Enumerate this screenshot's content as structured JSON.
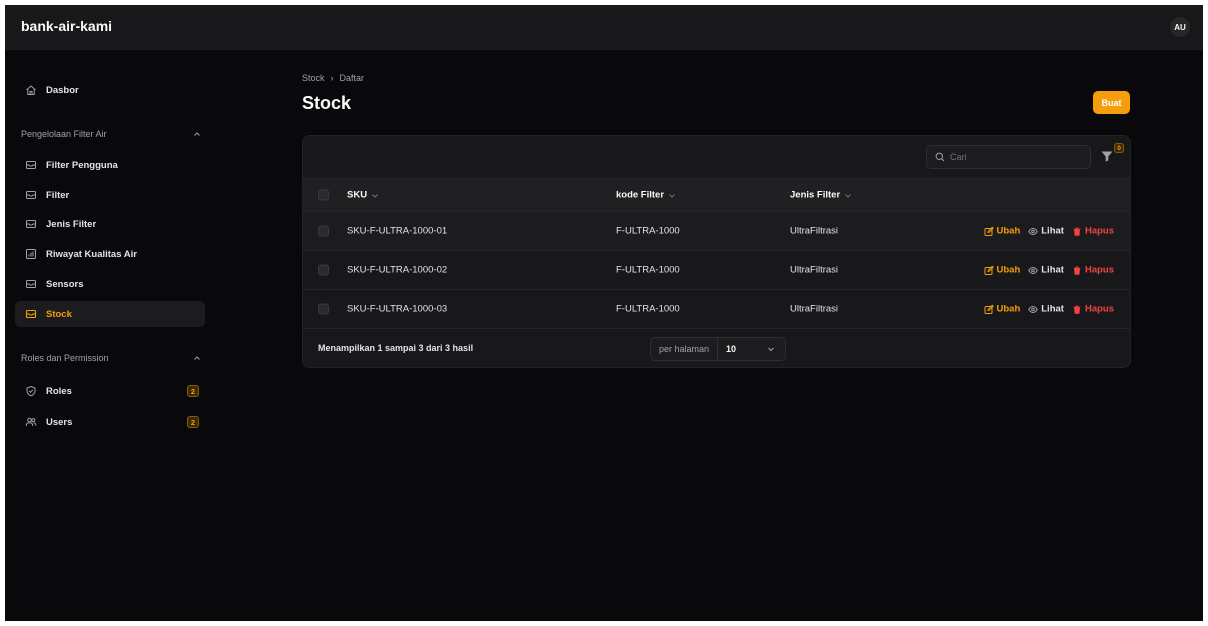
{
  "app": {
    "brand": "bank-air-kami",
    "avatar_initials": "AU"
  },
  "sidebar": {
    "dashboard": {
      "label": "Dasbor",
      "icon": "home-icon"
    },
    "groups": [
      {
        "label": "Pengelolaan Filter Air",
        "items": [
          {
            "label": "Filter Pengguna",
            "icon": "inbox-icon"
          },
          {
            "label": "Filter",
            "icon": "inbox-icon"
          },
          {
            "label": "Jenis Filter",
            "icon": "inbox-icon"
          },
          {
            "label": "Riwayat Kualitas Air",
            "icon": "chart-icon"
          },
          {
            "label": "Sensors",
            "icon": "inbox-icon"
          },
          {
            "label": "Stock",
            "icon": "inbox-icon",
            "active": true
          }
        ]
      },
      {
        "label": "Roles dan Permission",
        "items": [
          {
            "label": "Roles",
            "icon": "shield-check-icon",
            "badge": "2"
          },
          {
            "label": "Users",
            "icon": "users-icon",
            "badge": "2"
          }
        ]
      }
    ]
  },
  "page": {
    "breadcrumb": [
      "Stock",
      "Daftar"
    ],
    "title": "Stock",
    "create_label": "Buat"
  },
  "table": {
    "search_placeholder": "Cari",
    "filter_count": "0",
    "columns": [
      "SKU",
      "kode Filter",
      "Jenis Filter"
    ],
    "rows": [
      {
        "sku": "SKU-F-ULTRA-1000-01",
        "kode": "F-ULTRA-1000",
        "jenis": "UltraFiltrasi"
      },
      {
        "sku": "SKU-F-ULTRA-1000-02",
        "kode": "F-ULTRA-1000",
        "jenis": "UltraFiltrasi"
      },
      {
        "sku": "SKU-F-ULTRA-1000-03",
        "kode": "F-ULTRA-1000",
        "jenis": "UltraFiltrasi"
      }
    ],
    "actions": {
      "edit": "Ubah",
      "view": "Lihat",
      "delete": "Hapus"
    },
    "summary": "Menampilkan 1 sampai 3 dari 3 hasil",
    "per_page_label": "per halaman",
    "per_page_value": "10"
  },
  "colors": {
    "accent": "#f59e0b",
    "danger": "#ef4444",
    "background": "#09090b",
    "surface": "#18181b"
  }
}
